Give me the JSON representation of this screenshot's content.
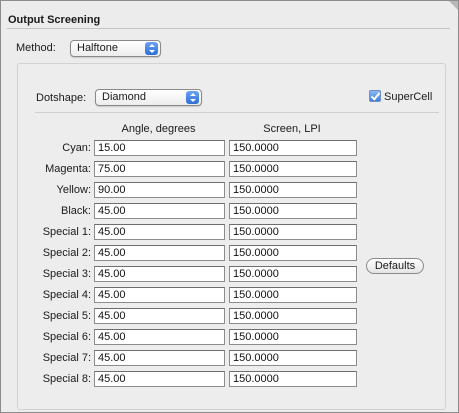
{
  "panel": {
    "title": "Output Screening"
  },
  "method": {
    "label": "Method:",
    "value": "Halftone"
  },
  "dotshape": {
    "label": "Dotshape:",
    "value": "Diamond"
  },
  "supercell": {
    "label": "SuperCell",
    "checked": true
  },
  "columns": {
    "angle": "Angle, degrees",
    "screen": "Screen, LPI"
  },
  "rows": [
    {
      "label": "Cyan:",
      "angle": "15.00",
      "screen": "150.0000"
    },
    {
      "label": "Magenta:",
      "angle": "75.00",
      "screen": "150.0000"
    },
    {
      "label": "Yellow:",
      "angle": "90.00",
      "screen": "150.0000"
    },
    {
      "label": "Black:",
      "angle": "45.00",
      "screen": "150.0000"
    },
    {
      "label": "Special 1:",
      "angle": "45.00",
      "screen": "150.0000"
    },
    {
      "label": "Special 2:",
      "angle": "45.00",
      "screen": "150.0000"
    },
    {
      "label": "Special 3:",
      "angle": "45.00",
      "screen": "150.0000"
    },
    {
      "label": "Special 4:",
      "angle": "45.00",
      "screen": "150.0000"
    },
    {
      "label": "Special 5:",
      "angle": "45.00",
      "screen": "150.0000"
    },
    {
      "label": "Special 6:",
      "angle": "45.00",
      "screen": "150.0000"
    },
    {
      "label": "Special 7:",
      "angle": "45.00",
      "screen": "150.0000"
    },
    {
      "label": "Special 8:",
      "angle": "45.00",
      "screen": "150.0000"
    }
  ],
  "buttons": {
    "defaults": "Defaults"
  },
  "colors": {
    "accent": "#3f7fe0",
    "panel_bg": "#ececec"
  }
}
